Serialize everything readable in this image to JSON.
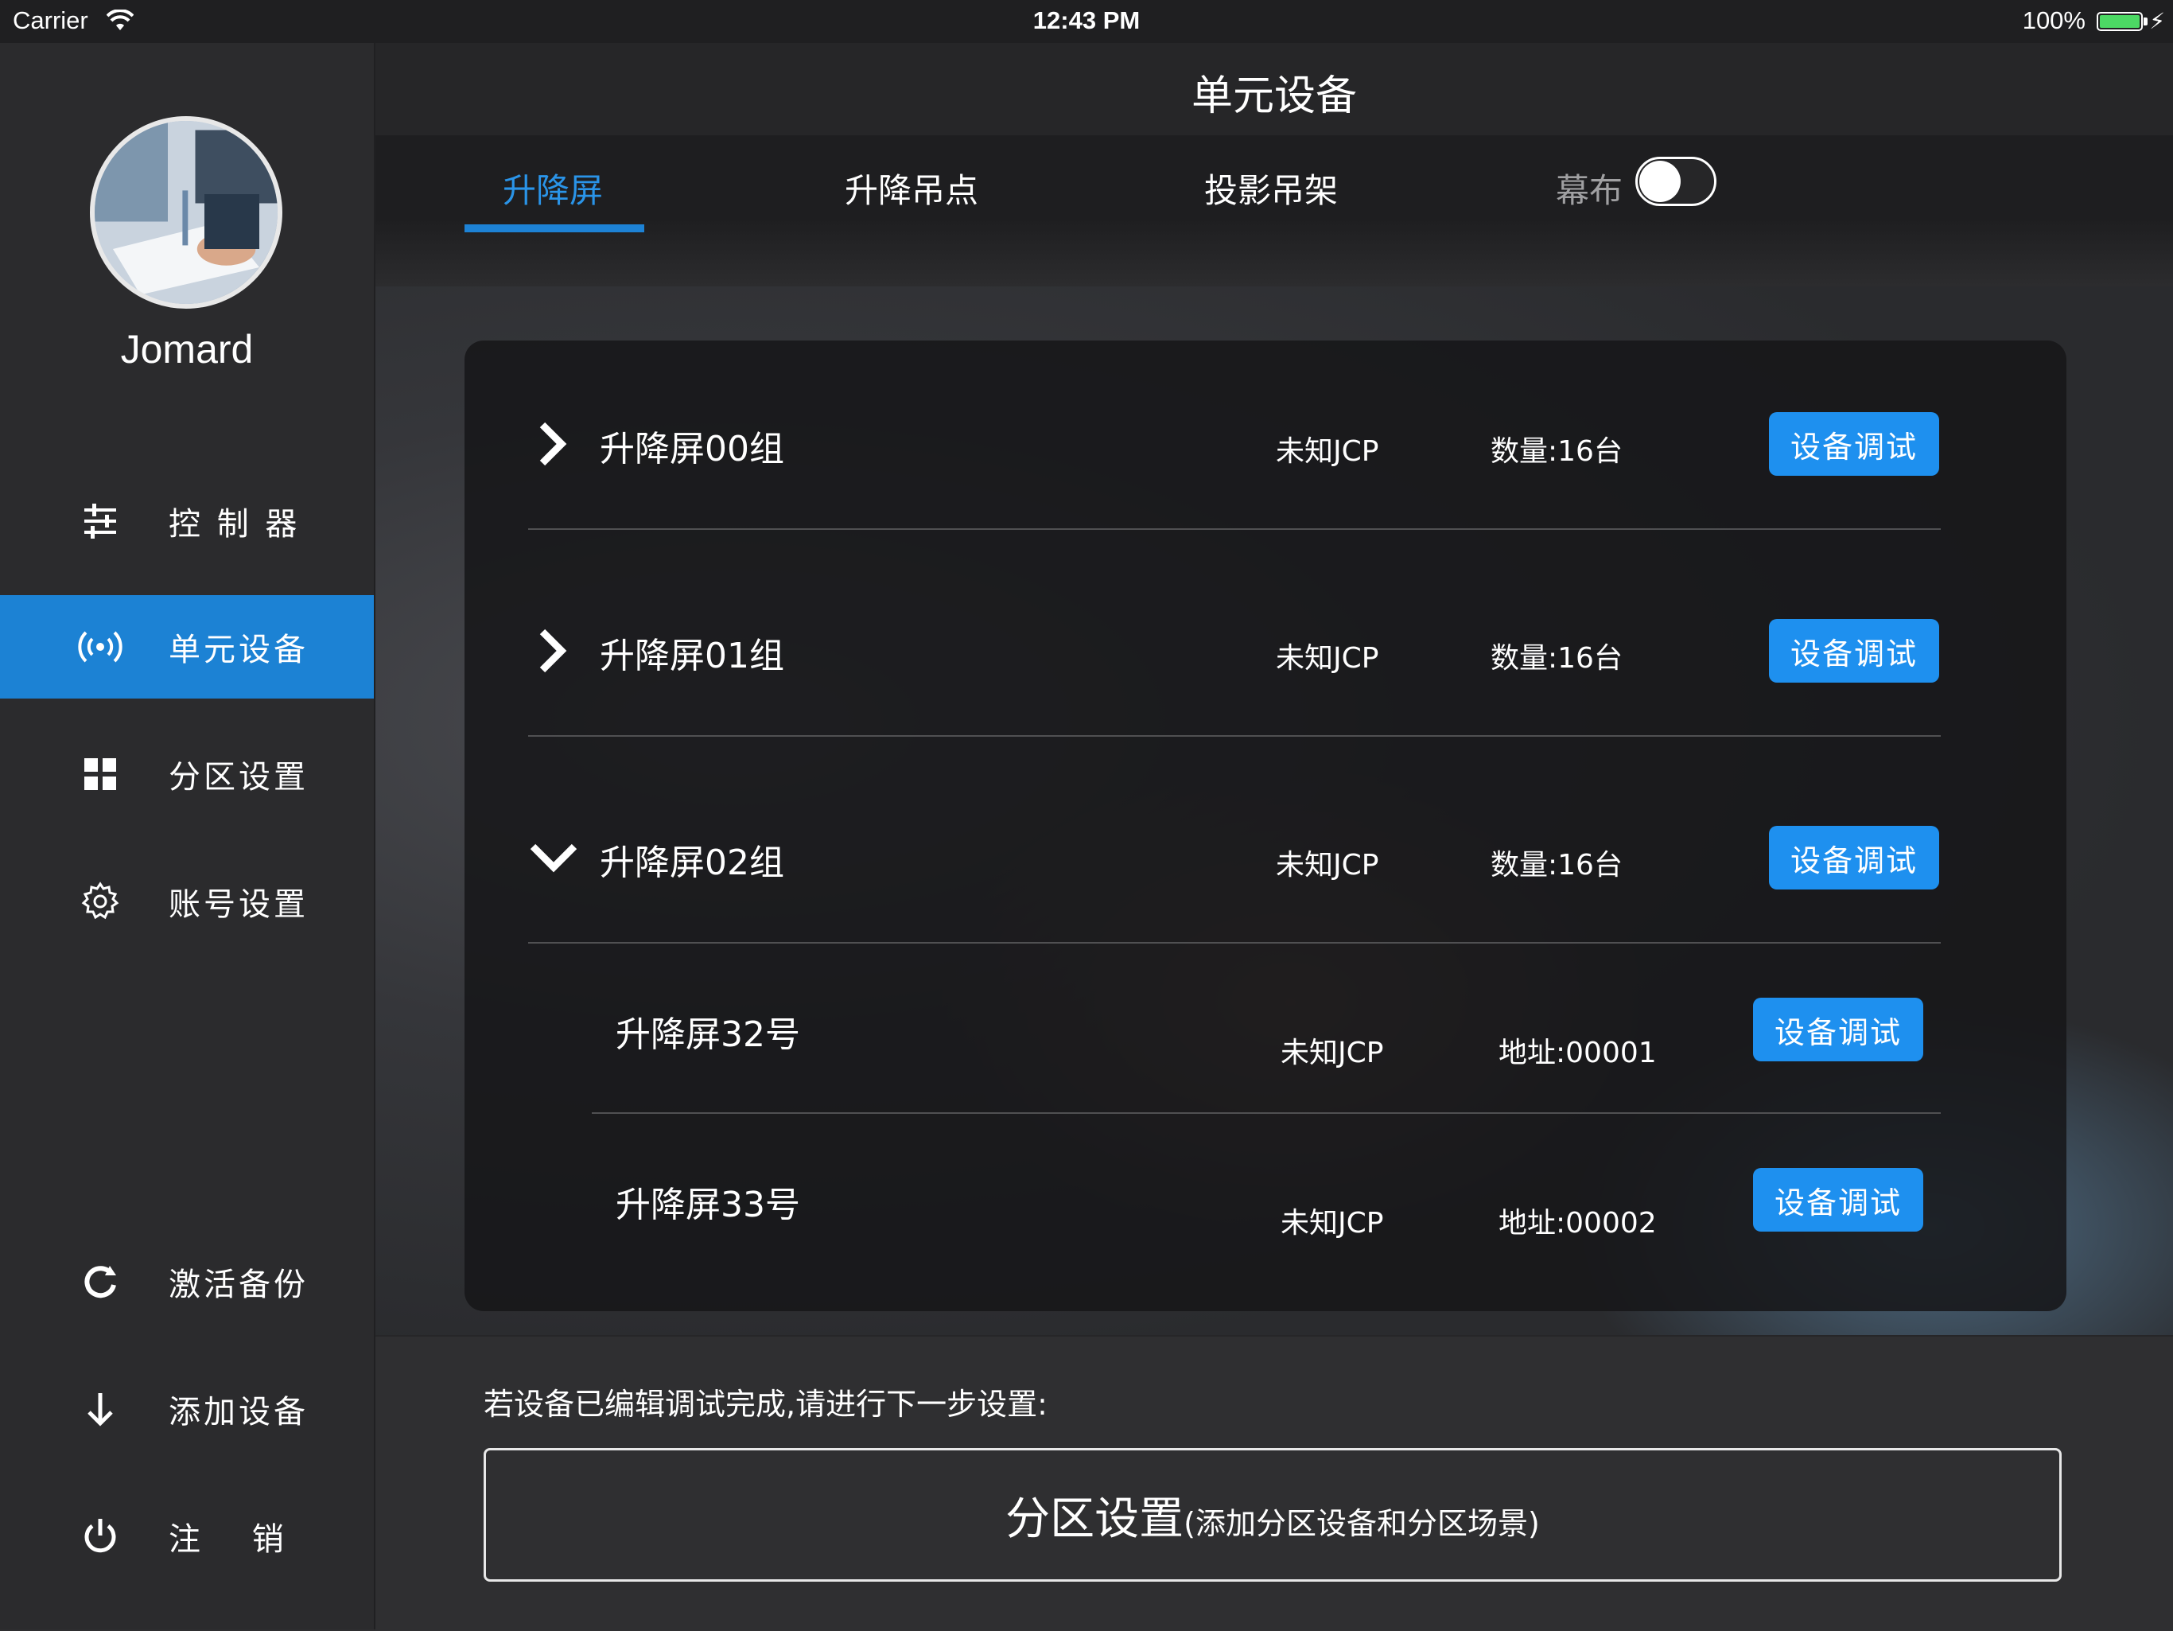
{
  "status_bar": {
    "carrier": "Carrier",
    "time": "12:43 PM",
    "battery": "100%"
  },
  "sidebar": {
    "username": "Jomard",
    "items": [
      {
        "label": "控 制 器",
        "icon": "sliders-icon",
        "active": false
      },
      {
        "label": "单元设备",
        "icon": "broadcast-icon",
        "active": true
      },
      {
        "label": "分区设置",
        "icon": "grid-icon",
        "active": false
      },
      {
        "label": "账号设置",
        "icon": "gear-icon",
        "active": false
      },
      {
        "label": "激活备份",
        "icon": "refresh-icon",
        "active": false
      },
      {
        "label": "添加设备",
        "icon": "download-arrow-icon",
        "active": false
      },
      {
        "label": "注 销",
        "icon": "power-icon",
        "active": false
      }
    ]
  },
  "header": {
    "title": "单元设备"
  },
  "tabs": {
    "items": [
      "升降屏",
      "升降吊点",
      "投影吊架"
    ],
    "active_index": 0,
    "toggle_label": "幕布",
    "toggle_on": false
  },
  "groups": [
    {
      "name": "升降屏00组",
      "type": "未知JCP",
      "count": "数量:16台",
      "button": "设备调试",
      "expanded": false
    },
    {
      "name": "升降屏01组",
      "type": "未知JCP",
      "count": "数量:16台",
      "button": "设备调试",
      "expanded": false
    },
    {
      "name": "升降屏02组",
      "type": "未知JCP",
      "count": "数量:16台",
      "button": "设备调试",
      "expanded": true
    }
  ],
  "devices": [
    {
      "name": "升降屏32号",
      "type": "未知JCP",
      "address": "地址:00001",
      "button": "设备调试"
    },
    {
      "name": "升降屏33号",
      "type": "未知JCP",
      "address": "地址:00002",
      "button": "设备调试"
    }
  ],
  "footer": {
    "note": "若设备已编辑调试完成,请进行下一步设置:",
    "button_main": "分区设置",
    "button_sub": "(添加分区设备和分区场景)"
  },
  "colors": {
    "accent": "#1e90ef",
    "active_nav": "#1c82d4",
    "active_tab": "#2a94e8"
  }
}
